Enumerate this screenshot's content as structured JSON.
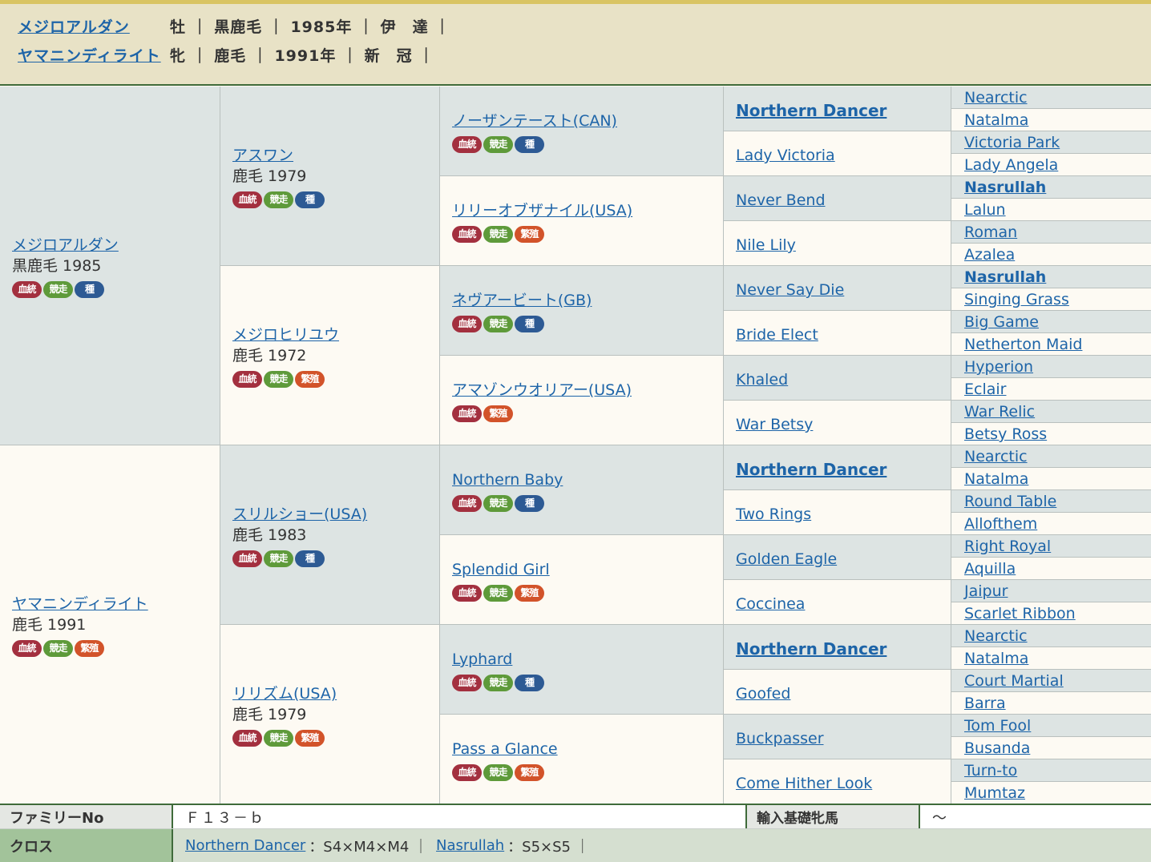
{
  "header": {
    "rows": [
      {
        "name": "メジロアルダン",
        "info": "牡 ｜ 黒鹿毛 ｜ 1985年 ｜ 伊　達 ｜"
      },
      {
        "name": "ヤマニンディライト",
        "info": "牝 ｜ 鹿毛 ｜ 1991年 ｜ 新　冠 ｜"
      }
    ]
  },
  "badges": {
    "blood": "血統",
    "race": "競走",
    "stud": "種",
    "breed": "繁殖"
  },
  "gen1": [
    {
      "name": "メジロアルダン",
      "sub": "黒鹿毛 1985",
      "badges": [
        "blood",
        "race",
        "stud"
      ]
    },
    {
      "name": "ヤマニンディライト",
      "sub": "鹿毛 1991",
      "badges": [
        "blood",
        "race",
        "breed"
      ]
    }
  ],
  "gen2": [
    {
      "name": "アスワン",
      "sub": "鹿毛 1979",
      "badges": [
        "blood",
        "race",
        "stud"
      ]
    },
    {
      "name": "メジロヒリユウ",
      "sub": "鹿毛 1972",
      "badges": [
        "blood",
        "race",
        "breed"
      ]
    },
    {
      "name": "スリルショー(USA)",
      "sub": "鹿毛 1983",
      "badges": [
        "blood",
        "race",
        "stud"
      ]
    },
    {
      "name": "リリズム(USA)",
      "sub": "鹿毛 1979",
      "badges": [
        "blood",
        "race",
        "breed"
      ]
    }
  ],
  "gen3": [
    {
      "name": "ノーザンテースト(CAN)",
      "badges": [
        "blood",
        "race",
        "stud"
      ]
    },
    {
      "name": "リリーオブザナイル(USA)",
      "badges": [
        "blood",
        "race",
        "breed"
      ]
    },
    {
      "name": "ネヴアービート(GB)",
      "badges": [
        "blood",
        "race",
        "stud"
      ]
    },
    {
      "name": "アマゾンウオリアー(USA)",
      "badges": [
        "blood",
        "breed"
      ]
    },
    {
      "name": "Northern Baby",
      "badges": [
        "blood",
        "race",
        "stud"
      ]
    },
    {
      "name": "Splendid Girl",
      "badges": [
        "blood",
        "race",
        "breed"
      ]
    },
    {
      "name": "Lyphard",
      "badges": [
        "blood",
        "race",
        "stud"
      ]
    },
    {
      "name": "Pass a Glance",
      "badges": [
        "blood",
        "race",
        "breed"
      ]
    }
  ],
  "gen4": [
    {
      "name": "Northern Dancer",
      "strong": true
    },
    {
      "name": "Lady Victoria",
      "strong": false
    },
    {
      "name": "Never Bend",
      "strong": false
    },
    {
      "name": "Nile Lily",
      "strong": false
    },
    {
      "name": "Never Say Die",
      "strong": false
    },
    {
      "name": "Bride Elect",
      "strong": false
    },
    {
      "name": "Khaled",
      "strong": false
    },
    {
      "name": "War Betsy",
      "strong": false
    },
    {
      "name": "Northern Dancer",
      "strong": true
    },
    {
      "name": "Two Rings",
      "strong": false
    },
    {
      "name": "Golden Eagle",
      "strong": false
    },
    {
      "name": "Coccinea",
      "strong": false
    },
    {
      "name": "Northern Dancer",
      "strong": true
    },
    {
      "name": "Goofed",
      "strong": false
    },
    {
      "name": "Buckpasser",
      "strong": false
    },
    {
      "name": "Come Hither Look",
      "strong": false
    }
  ],
  "gen5": [
    {
      "name": "Nearctic",
      "strong": false
    },
    {
      "name": "Natalma",
      "strong": false
    },
    {
      "name": "Victoria Park",
      "strong": false
    },
    {
      "name": "Lady Angela",
      "strong": false
    },
    {
      "name": "Nasrullah",
      "strong": true
    },
    {
      "name": "Lalun",
      "strong": false
    },
    {
      "name": "Roman",
      "strong": false
    },
    {
      "name": "Azalea",
      "strong": false
    },
    {
      "name": "Nasrullah",
      "strong": true
    },
    {
      "name": "Singing Grass",
      "strong": false
    },
    {
      "name": "Big Game",
      "strong": false
    },
    {
      "name": "Netherton Maid",
      "strong": false
    },
    {
      "name": "Hyperion",
      "strong": false
    },
    {
      "name": "Eclair",
      "strong": false
    },
    {
      "name": "War Relic",
      "strong": false
    },
    {
      "name": "Betsy Ross",
      "strong": false
    },
    {
      "name": "Nearctic",
      "strong": false
    },
    {
      "name": "Natalma",
      "strong": false
    },
    {
      "name": "Round Table",
      "strong": false
    },
    {
      "name": "Allofthem",
      "strong": false
    },
    {
      "name": "Right Royal",
      "strong": false
    },
    {
      "name": "Aquilla",
      "strong": false
    },
    {
      "name": "Jaipur",
      "strong": false
    },
    {
      "name": "Scarlet Ribbon",
      "strong": false
    },
    {
      "name": "Nearctic",
      "strong": false
    },
    {
      "name": "Natalma",
      "strong": false
    },
    {
      "name": "Court Martial",
      "strong": false
    },
    {
      "name": "Barra",
      "strong": false
    },
    {
      "name": "Tom Fool",
      "strong": false
    },
    {
      "name": "Busanda",
      "strong": false
    },
    {
      "name": "Turn-to",
      "strong": false
    },
    {
      "name": "Mumtaz",
      "strong": false
    }
  ],
  "footer": {
    "family_label": "ファミリーNo",
    "family_value": "Ｆ１３－ｂ",
    "import_label": "輸入基礎牝馬",
    "import_value": "～",
    "cross_label": "クロス",
    "crosses": [
      {
        "name": "Northern Dancer",
        "detail": "：S4×M4×M4 ｜"
      },
      {
        "name": "Nasrullah",
        "detail": "：S5×S5 ｜"
      }
    ]
  },
  "colors": {
    "link": "#1d64a8",
    "header_bg": "#e8e2c6",
    "top_bar": "#d9c463",
    "tinted_cell": "#dde4e3",
    "light_cell": "#fdfaf3",
    "footer_green": "#3f6b3a",
    "cross_row_bg": "#d5dfd0",
    "cross_label_bg": "#a2c39a",
    "family_label_bg": "#e4e7e3"
  }
}
